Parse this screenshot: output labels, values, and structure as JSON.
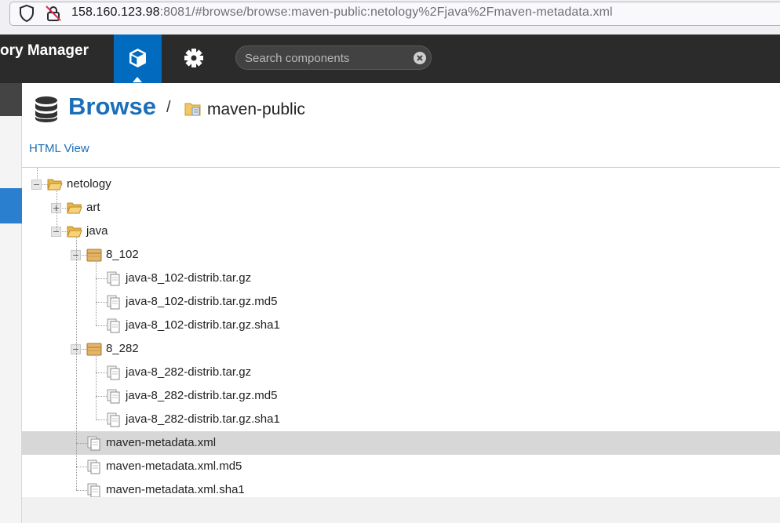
{
  "browser": {
    "url_host": "158.160.123.98",
    "url_rest": ":8081/#browse/browse:maven-public:netology%2Fjava%2Fmaven-metadata.xml"
  },
  "header": {
    "app_title": "ory Manager",
    "nav_browse_icon": "cube-icon",
    "nav_admin_icon": "gear-icon",
    "search_placeholder": "Search components"
  },
  "page": {
    "title": "Browse",
    "separator": "/",
    "repository": "maven-public",
    "html_view": "HTML View"
  },
  "tree": [
    {
      "label": "netology",
      "icon": "folder-open-icon",
      "depth": 0,
      "expander": "minus",
      "selected": false
    },
    {
      "label": "art",
      "icon": "folder-open-icon",
      "depth": 1,
      "expander": "plus",
      "selected": false
    },
    {
      "label": "java",
      "icon": "folder-open-icon",
      "depth": 1,
      "expander": "minus",
      "selected": false
    },
    {
      "label": "8_102",
      "icon": "package-icon",
      "depth": 2,
      "expander": "minus",
      "selected": false
    },
    {
      "label": "java-8_102-distrib.tar.gz",
      "icon": "file-icon",
      "depth": 3,
      "expander": "none",
      "selected": false
    },
    {
      "label": "java-8_102-distrib.tar.gz.md5",
      "icon": "file-icon",
      "depth": 3,
      "expander": "none",
      "selected": false
    },
    {
      "label": "java-8_102-distrib.tar.gz.sha1",
      "icon": "file-icon",
      "depth": 3,
      "expander": "none",
      "selected": false
    },
    {
      "label": "8_282",
      "icon": "package-icon",
      "depth": 2,
      "expander": "minus",
      "selected": false
    },
    {
      "label": "java-8_282-distrib.tar.gz",
      "icon": "file-icon",
      "depth": 3,
      "expander": "none",
      "selected": false
    },
    {
      "label": "java-8_282-distrib.tar.gz.md5",
      "icon": "file-icon",
      "depth": 3,
      "expander": "none",
      "selected": false
    },
    {
      "label": "java-8_282-distrib.tar.gz.sha1",
      "icon": "file-icon",
      "depth": 3,
      "expander": "none",
      "selected": false
    },
    {
      "label": "maven-metadata.xml",
      "icon": "file-icon",
      "depth": 2,
      "expander": "none",
      "selected": true
    },
    {
      "label": "maven-metadata.xml.md5",
      "icon": "file-icon",
      "depth": 2,
      "expander": "none",
      "selected": false
    },
    {
      "label": "maven-metadata.xml.sha1",
      "icon": "file-icon",
      "depth": 2,
      "expander": "none",
      "selected": false
    }
  ],
  "colors": {
    "header_bg": "#2b2b2b",
    "nav_active": "#006bbf",
    "title_blue": "#1a6fb8",
    "selected_row": "#d7d7d7"
  }
}
